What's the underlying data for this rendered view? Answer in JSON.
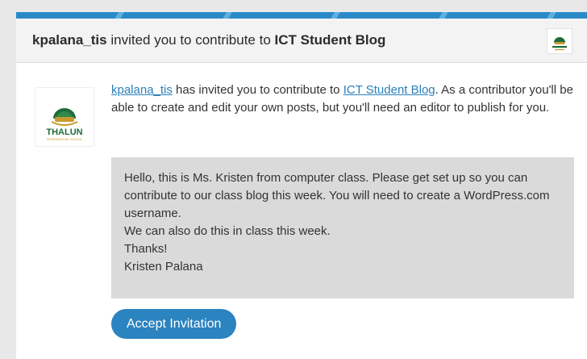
{
  "header": {
    "inviter": "kpalana_tis",
    "mid_text": " invited you to contribute to ",
    "blog_name": "ICT Student Blog",
    "logo_icon": "thalun-school-logo"
  },
  "intro": {
    "inviter_link": "kpalana_tis",
    "text1": " has invited you to contribute to ",
    "blog_link": "ICT Student Blog",
    "text2": ". As a contributor you'll be able to create and edit your own posts, but you'll need an editor to publish for you."
  },
  "avatar": {
    "label": "THALUN",
    "sublabel": "INTERNATIONAL SCHOOL"
  },
  "message": {
    "lines": [
      "Hello, this is Ms. Kristen from computer class. Please get set up so you can contribute to our class blog this week. You will need to create a WordPress.com username.",
      "We can also do this in class this week.",
      "Thanks!",
      "Kristen Palana"
    ]
  },
  "actions": {
    "accept_label": "Accept Invitation"
  },
  "colors": {
    "accent": "#2b83bf",
    "link": "#2a7fb9",
    "message_bg": "#dadada",
    "logo_green": "#1f6b3a",
    "logo_gold": "#c99a2e"
  }
}
